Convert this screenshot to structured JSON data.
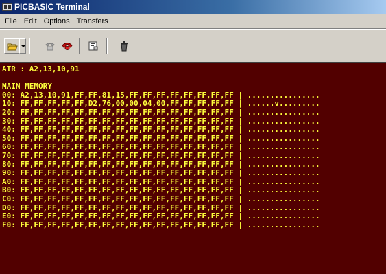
{
  "window": {
    "title": "PICBASIC Terminal"
  },
  "menu": [
    "File",
    "Edit",
    "Options",
    "Transfers"
  ],
  "toolbar": [
    {
      "name": "open-folder-button",
      "icon": "folder-icon"
    },
    {
      "name": "open-dropdown-button",
      "icon": "chevron-down-icon"
    },
    {
      "name": "connect-button",
      "icon": "phone-icon"
    },
    {
      "name": "disconnect-button",
      "icon": "hangup-icon"
    },
    {
      "name": "properties-button",
      "icon": "properties-icon"
    },
    {
      "name": "delete-button",
      "icon": "trash-icon"
    }
  ],
  "colors": {
    "terminal_bg": "#520000",
    "terminal_text": "#ffff3c",
    "title_start": "#0a246a",
    "title_end": "#a6caf0"
  },
  "terminal": {
    "lines": [
      "ATR : A2,13,10,91",
      "",
      "MAIN MEMORY",
      "00: A2,13,10,91,FF,FF,81,15,FF,FF,FF,FF,FF,FF,FF,FF | ................",
      "10: FF,FF,FF,FF,FF,D2,76,00,00,04,00,FF,FF,FF,FF,FF | ......v.........",
      "20: FF,FF,FF,FF,FF,FF,FF,FF,FF,FF,FF,FF,FF,FF,FF,FF | ................",
      "30: FF,FF,FF,FF,FF,FF,FF,FF,FF,FF,FF,FF,FF,FF,FF,FF | ................",
      "40: FF,FF,FF,FF,FF,FF,FF,FF,FF,FF,FF,FF,FF,FF,FF,FF | ................",
      "50: FF,FF,FF,FF,FF,FF,FF,FF,FF,FF,FF,FF,FF,FF,FF,FF | ................",
      "60: FF,FF,FF,FF,FF,FF,FF,FF,FF,FF,FF,FF,FF,FF,FF,FF | ................",
      "70: FF,FF,FF,FF,FF,FF,FF,FF,FF,FF,FF,FF,FF,FF,FF,FF | ................",
      "80: FF,FF,FF,FF,FF,FF,FF,FF,FF,FF,FF,FF,FF,FF,FF,FF | ................",
      "90: FF,FF,FF,FF,FF,FF,FF,FF,FF,FF,FF,FF,FF,FF,FF,FF | ................",
      "A0: FF,FF,FF,FF,FF,FF,FF,FF,FF,FF,FF,FF,FF,FF,FF,FF | ................",
      "B0: FF,FF,FF,FF,FF,FF,FF,FF,FF,FF,FF,FF,FF,FF,FF,FF | ................",
      "C0: FF,FF,FF,FF,FF,FF,FF,FF,FF,FF,FF,FF,FF,FF,FF,FF | ................",
      "D0: FF,FF,FF,FF,FF,FF,FF,FF,FF,FF,FF,FF,FF,FF,FF,FF | ................",
      "E0: FF,FF,FF,FF,FF,FF,FF,FF,FF,FF,FF,FF,FF,FF,FF,FF | ................",
      "F0: FF,FF,FF,FF,FF,FF,FF,FF,FF,FF,FF,FF,FF,FF,FF,FF | ................"
    ]
  }
}
